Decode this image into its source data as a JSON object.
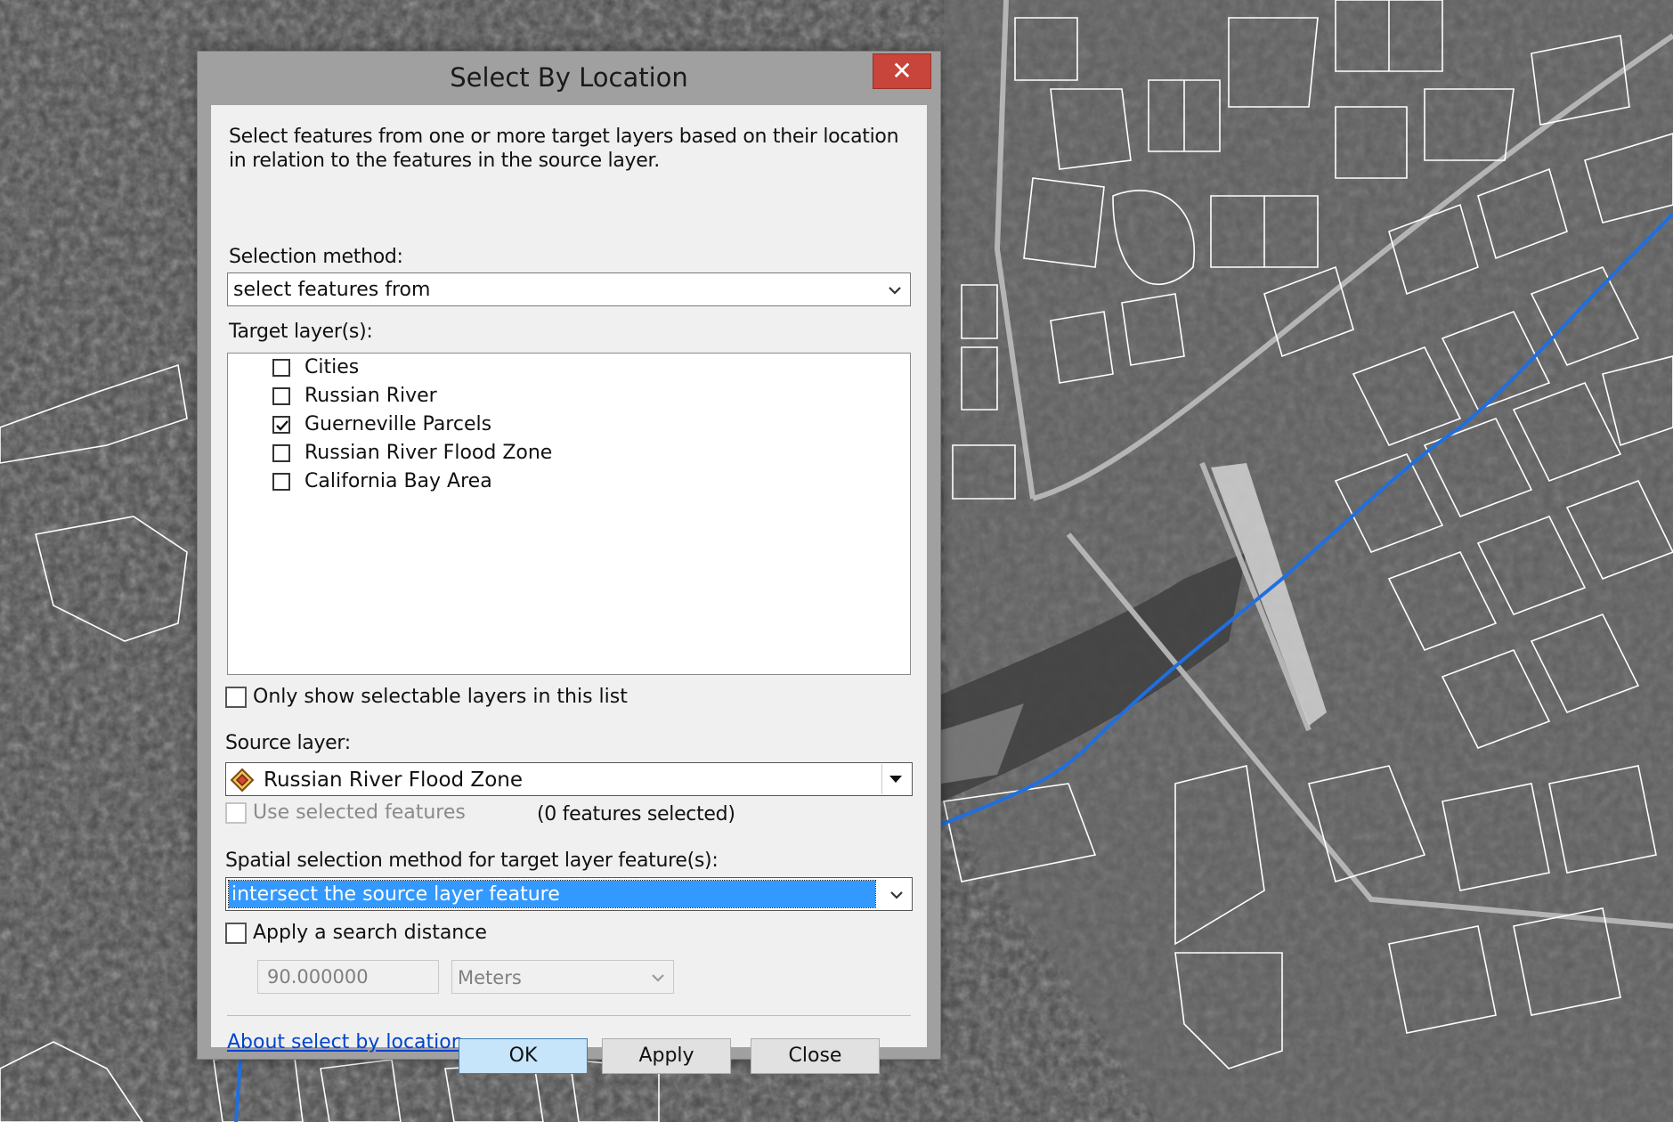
{
  "dialog": {
    "title": "Select By Location",
    "close_glyph": "✕",
    "description": "Select features from one or more target layers based on their location in relation to the features in the source layer.",
    "selection_method_label": "Selection method:",
    "selection_method_value": "select features from",
    "target_layers_label": "Target layer(s):",
    "target_layers": [
      {
        "label": "Cities",
        "checked": false
      },
      {
        "label": "Russian River",
        "checked": false
      },
      {
        "label": "Guerneville Parcels",
        "checked": true
      },
      {
        "label": "Russian River Flood Zone",
        "checked": false
      },
      {
        "label": "California Bay Area",
        "checked": false
      }
    ],
    "only_selectable_label": "Only show selectable layers in this list",
    "source_layer_label": "Source layer:",
    "source_layer_value": "Russian River Flood Zone",
    "use_selected_label": "Use selected features",
    "features_selected_text": "(0 features selected)",
    "spatial_method_label": "Spatial selection method for target layer feature(s):",
    "spatial_method_value": "intersect the source layer feature",
    "search_distance_label": "Apply a search distance",
    "search_distance_value": "90.000000",
    "search_distance_units": "Meters",
    "help_link": "About select by location",
    "buttons": {
      "ok": "OK",
      "apply": "Apply",
      "close": "Close"
    }
  },
  "colors": {
    "close_button": "#c7453b",
    "selection_highlight": "#3399ff",
    "link": "#0044cc",
    "ok_button": "#c6e5fb",
    "river_line": "#1f6fe0",
    "parcel_lines": "#ffffff"
  },
  "icons": {
    "close": "close-icon",
    "checkbox": "checkbox-icon",
    "dropdown": "chevron-down-icon",
    "source_layer": "polygon-layer-icon"
  }
}
